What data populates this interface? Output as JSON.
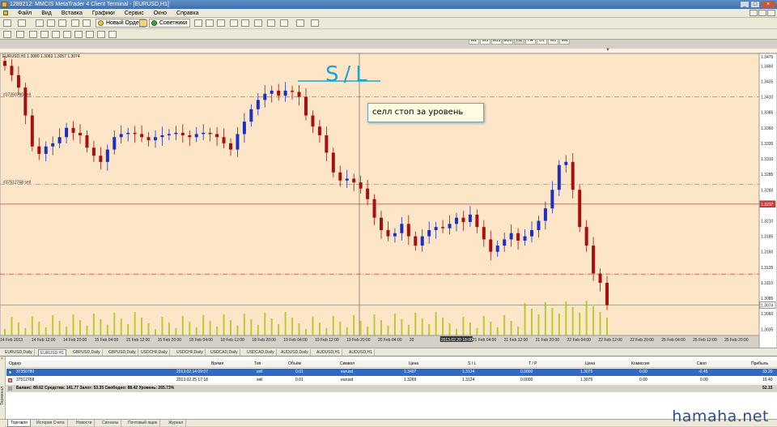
{
  "window": {
    "title": "1289212: MMCIS MetaTrader 4 Client Terminal - [EURUSD,H1]"
  },
  "menu": [
    "Файл",
    "Вид",
    "Вставка",
    "Графики",
    "Сервис",
    "Окно",
    "Справка"
  ],
  "toolbar": {
    "new_order": "Новый Ордер",
    "advisors": "Советники"
  },
  "periods": [
    "M1",
    "M5",
    "M15",
    "M30",
    "H1",
    "H4",
    "D1",
    "W1",
    "MN"
  ],
  "active_period": "H1",
  "chart": {
    "header": "EURUSD,H1  1.3080 1.3083 1.3057 1.3074",
    "annotation_sl": "S/L",
    "annotation_box": "селл стоп за уровень",
    "order_label_1": "#37350780 sell",
    "order_label_2": "#37512768 sell",
    "colors": {
      "background": "#fde5c7",
      "bull": "#1c2fc0",
      "bear": "#a80f0f",
      "volume": "#9ec400",
      "hline_green": "#6bbf4e",
      "hline_red": "#d93a3a",
      "annotation": "#1ea4d2"
    }
  },
  "chart_data": {
    "type": "candlestick",
    "symbol": "EURUSD",
    "timeframe": "H1",
    "price_axis": [
      "1.3475",
      "1.3460",
      "1.3435",
      "1.3410",
      "1.3385",
      "1.3360",
      "1.3335",
      "1.3310",
      "1.3285",
      "1.3260",
      "1.3237",
      "1.3210",
      "1.3185",
      "1.3160",
      "1.3135",
      "1.3110",
      "1.3085",
      "1.3074",
      "1.3060",
      "1.3035"
    ],
    "ylim": [
      1.3025,
      1.348
    ],
    "time_axis": [
      "14 Feb 2013",
      "14 Feb 12:00",
      "14 Feb 20:00",
      "15 Feb 04:00",
      "15 Feb 12:00",
      "15 Feb 20:00",
      "18 Feb 04:00",
      "18 Feb 12:00",
      "18 Feb 20:00",
      "19 Feb 04:00",
      "19 Feb 12:00",
      "19 Feb 20:00",
      "20 Feb 04:00",
      "20",
      "2013.02.20 18:00",
      "21 Feb 04:00",
      "21 Feb 12:00",
      "21 Feb 20:00",
      "22 Feb 04:00",
      "22 Feb 12:00",
      "22 Feb 20:00",
      "25 Feb 04:00",
      "25 Feb 12:00",
      "25 Feb 20:00"
    ],
    "current_price": "1.3074",
    "highlight_price": "1.3237",
    "hlines": [
      {
        "price": 1.341,
        "style": "dashdot",
        "color": "#6bbf4e"
      },
      {
        "price": 1.3269,
        "style": "dashdot",
        "color": "#6bbf4e"
      },
      {
        "price": 1.3237,
        "style": "solid",
        "color": "#d93a3a"
      },
      {
        "price": 1.3124,
        "style": "dashdot",
        "color": "#d93a3a"
      },
      {
        "price": 1.3074,
        "style": "solid",
        "color": "#8a8a7a"
      }
    ],
    "crosshair_time": "2013.02.20 18:00",
    "closes": [
      1.346,
      1.3445,
      1.3425,
      1.338,
      1.333,
      1.3318,
      1.333,
      1.3335,
      1.3345,
      1.336,
      1.3352,
      1.3348,
      1.3328,
      1.3315,
      1.3305,
      1.3325,
      1.3345,
      1.335,
      1.3352,
      1.335,
      1.3345,
      1.334,
      1.3345,
      1.3348,
      1.335,
      1.3352,
      1.3348,
      1.3345,
      1.335,
      1.3352,
      1.335,
      1.3345,
      1.3335,
      1.3325,
      1.335,
      1.337,
      1.339,
      1.3405,
      1.3415,
      1.342,
      1.3412,
      1.342,
      1.3418,
      1.341,
      1.338,
      1.3362,
      1.3348,
      1.332,
      1.3288,
      1.3275,
      1.3278,
      1.3272,
      1.3262,
      1.3245,
      1.3215,
      1.3195,
      1.3185,
      1.319,
      1.3205,
      1.3185,
      1.317,
      1.3185,
      1.3195,
      1.32,
      1.3198,
      1.3205,
      1.3215,
      1.3208,
      1.322,
      1.32,
      1.318,
      1.316,
      1.317,
      1.318,
      1.319,
      1.3178,
      1.3185,
      1.3195,
      1.321,
      1.323,
      1.326,
      1.33,
      1.3305,
      1.326,
      1.32,
      1.317,
      1.3125,
      1.311,
      1.3074
    ]
  },
  "chart_tabs": [
    "EURUSD,Daily",
    "EURUSD,H1",
    "GBPUSD,Daily",
    "GBPUSD,Daily",
    "USDCHF,Daily",
    "USDCHF,Daily",
    "USDCAD,Daily",
    "USDCAD,Daily",
    "AUDUSD,Daily",
    "AUDUSD,H1",
    "AUDUSD,H1"
  ],
  "active_chart_tab": "EURUSD,H1",
  "terminal": {
    "side_label": "Терминал",
    "headers": {
      "order": "Ордер",
      "time": "Время",
      "type": "Тип",
      "volume": "Объём",
      "symbol": "Символ",
      "price": "Цена",
      "sl": "S / L",
      "tp": "T / P",
      "price2": "Цена",
      "commission": "Комиссия",
      "swap": "Своп",
      "profit": "Прибыль"
    },
    "rows": [
      {
        "order": "37350780",
        "time": "2013.02.14 09:07",
        "type": "sell",
        "volume": "0.01",
        "symbol": "eurusd",
        "price": "1.3407",
        "sl": "1.3124",
        "tp": "0.0000",
        "price2": "1.3075",
        "commission": "0.00",
        "swap": "-0.45",
        "profit": "33.20"
      },
      {
        "order": "37512768",
        "time": "2013.02.25 17:18",
        "type": "sell",
        "volume": "0.01",
        "symbol": "eurusd",
        "price": "1.3269",
        "sl": "1.3124",
        "tp": "0.0000",
        "price2": "1.3075",
        "commission": "0.00",
        "swap": "0.00",
        "profit": "19.40"
      }
    ],
    "balance_line": "Баланс: 89.62  Средства: 141.77  Залог: 53.35  Свободно: 88.42  Уровень: 265.73%",
    "balance_profit": "52.15"
  },
  "bottom_tabs": [
    "Торговля",
    "История Счета",
    "Новости",
    "Сигналы",
    "Почтовый ящик",
    "Журнал"
  ],
  "active_bottom_tab": "Торговля",
  "watermark": "hamaha.net"
}
